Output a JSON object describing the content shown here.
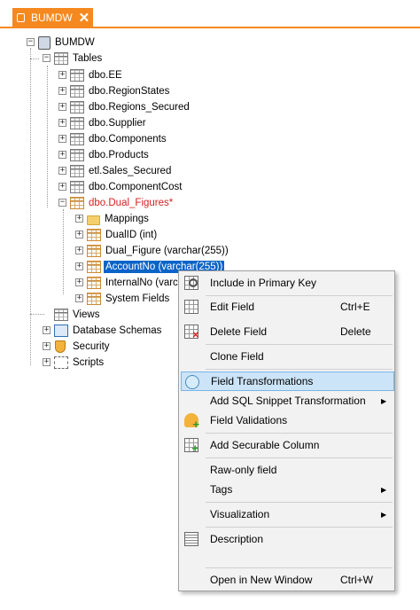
{
  "tab": {
    "title": "BUMDW",
    "close": "✕",
    "accent": "#f5891f"
  },
  "tree": {
    "root": "BUMDW",
    "tables_label": "Tables",
    "tables": [
      "dbo.EE",
      "dbo.RegionStates",
      "dbo.Regions_Secured",
      "dbo.Supplier",
      "dbo.Components",
      "dbo.Products",
      "etl.Sales_Secured",
      "dbo.ComponentCost",
      "dbo.Dual_Figures*"
    ],
    "dual_children": [
      "Mappings",
      "DualID (int)",
      "Dual_Figure (varchar(255))",
      "AccountNo (varchar(255))",
      "InternalNo (varchar(255))",
      "System Fields"
    ],
    "views": "Views",
    "database_schemas": "Database Schemas",
    "security": "Security",
    "scripts": "Scripts",
    "expander_plus": "+",
    "expander_minus": "−"
  },
  "menu": {
    "items": [
      {
        "label": "Include in Primary Key",
        "shortcut": "",
        "icon": "primary-key-icon"
      },
      {
        "label": "Edit Field",
        "shortcut": "Ctrl+E",
        "icon": "edit-field-icon"
      },
      {
        "label": "Delete Field",
        "shortcut": "Delete",
        "icon": "delete-field-icon"
      },
      {
        "label": "Clone Field",
        "shortcut": "",
        "icon": ""
      },
      {
        "label": "Field Transformations",
        "shortcut": "",
        "icon": "field-transformations-icon"
      },
      {
        "label": "Add SQL Snippet Transformation",
        "shortcut": "",
        "icon": "",
        "submenu": true
      },
      {
        "label": "Field Validations",
        "shortcut": "",
        "icon": "field-validations-icon"
      },
      {
        "label": "Add Securable Column",
        "shortcut": "",
        "icon": "securable-column-icon"
      },
      {
        "label": "Raw-only field",
        "shortcut": "",
        "icon": ""
      },
      {
        "label": "Tags",
        "shortcut": "",
        "icon": "",
        "submenu": true
      },
      {
        "label": "Visualization",
        "shortcut": "",
        "icon": "",
        "submenu": true
      },
      {
        "label": "Description",
        "shortcut": "",
        "icon": "description-icon"
      },
      {
        "label": "Open in New Window",
        "shortcut": "Ctrl+W",
        "icon": ""
      }
    ],
    "submenu_arrow": "▶",
    "hover_color": "#cce4f7",
    "selection_color": "#0a64c8"
  }
}
